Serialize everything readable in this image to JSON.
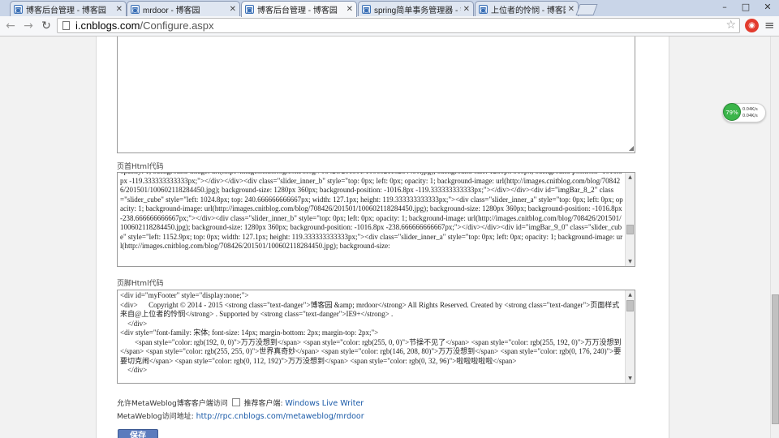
{
  "tabs": [
    {
      "title": "博客后台管理 - 博客园",
      "active": false
    },
    {
      "title": "mrdoor - 博客园",
      "active": false
    },
    {
      "title": "博客后台管理 - 博客园",
      "active": true
    },
    {
      "title": "spring简单事务管理器 - 钱",
      "active": false
    },
    {
      "title": "上位者的怜悯 - 博客园",
      "active": false
    }
  ],
  "window_controls": {
    "minimize": "–",
    "maximize": "□",
    "close": "✕"
  },
  "toolbar": {
    "back_icon": "back-arrow-icon",
    "forward_icon": "forward-arrow-icon",
    "reload_icon": "reload-icon",
    "url_host": "i.cnblogs.com",
    "url_path": "/Configure.aspx"
  },
  "page": {
    "header_html_label": "页首Html代码",
    "header_html_code": "opacity: 1; background-image: url(http://images.cnitblog.com/blog/708426/201501/100602118284450.jpg); background-size: 1280px 360px; background-position: -1016.8px -119.333333333333px;\"></div></div><div class=\"slider_inner_b\" style=\"top: 0px; left: 0px; opacity: 1; background-image: url(http://images.cnitblog.com/blog/708426/201501/100602118284450.jpg); background-size: 1280px 360px; background-position: -1016.8px -119.333333333333px;\"></div></div><div id=\"imgBar_8_2\" class=\"slider_cube\" style=\"left: 1024.8px; top: 240.666666666667px; width: 127.1px; height: 119.333333333333px;\"><div class=\"slider_inner_a\" style=\"top: 0px; left: 0px; opacity: 1; background-image: url(http://images.cnitblog.com/blog/708426/201501/100602118284450.jpg); background-size: 1280px 360px; background-position: -1016.8px -238.666666666667px;\"></div><div class=\"slider_inner_b\" style=\"top: 0px; left: 0px; opacity: 1; background-image: url(http://images.cnitblog.com/blog/708426/201501/100602118284450.jpg); background-size: 1280px 360px; background-position: -1016.8px -238.666666666667px;\"></div></div><div id=\"imgBar_9_0\" class=\"slider_cube\" style=\"left: 1152.9px; top: 0px; width: 127.1px; height: 119.333333333333px;\"><div class=\"slider_inner_a\" style=\"top: 0px; left: 0px; opacity: 1; background-image: url(http://images.cnitblog.com/blog/708426/201501/100602118284450.jpg); background-size:",
    "footer_html_label": "页脚Html代码",
    "footer_html_code": "<div id=\"myFooter\" style=\"display:none;\">\n<div>      Copyright © 2014 - 2015 <strong class=\"text-danger\">博客园 &amp; mrdoor</strong> All Rights Reserved. Created by <strong class=\"text-danger\">页面样式来自@上位者的怜悯</strong> . Supported by <strong class=\"text-danger\">IE9+</strong> .\n    </div>\n<div style=\"font-family: 宋体; font-size: 14px; margin-bottom: 2px; margin-top: 2px;\">\n        <span style=\"color: rgb(192, 0, 0)\">万万没想到</span> <span style=\"color: rgb(255, 0, 0)\">节操不见了</span> <span style=\"color: rgb(255, 192, 0)\">万万没想到</span> <span style=\"color: rgb(255, 255, 0)\">世界真奇妙</span> <span style=\"color: rgb(146, 208, 80)\">万万没想到</span> <span style=\"color: rgb(0, 176, 240)\">要要切克闹</span> <span style=\"color: rgb(0, 112, 192)\">万万没想到</span> <span style=\"color: rgb(0, 32, 96)\">啦啦啦啦啦</span>\n    </div>",
    "metaweblog_allow_label": "允许MetaWeblog博客客户端访问",
    "recommended_client_label": "推荐客户端:",
    "recommended_client_link": "Windows Live Writer",
    "metaweblog_address_label": "MetaWeblog访问地址:",
    "metaweblog_address_link": "http://rpc.cnblogs.com/metaweblog/mrdoor",
    "save_label": "保存"
  },
  "widget": {
    "percent": "79%",
    "upload_rate": "0.04K/s",
    "download_rate": "0.04K/s"
  },
  "colors": {
    "link": "#1a5aa8",
    "save_button": "#5b7bbd",
    "widget_green": "#3bb54a"
  }
}
